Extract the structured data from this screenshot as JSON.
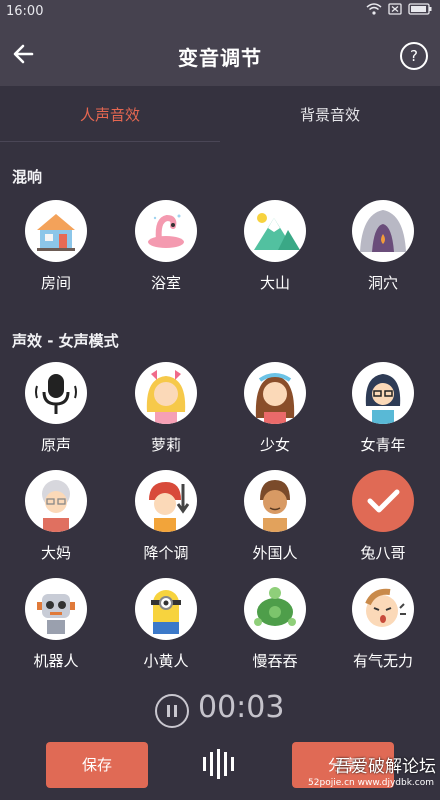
{
  "status": {
    "time": "16:00"
  },
  "header": {
    "title": "变音调节",
    "help": "?"
  },
  "tabs": [
    {
      "label": "人声音效",
      "active": true
    },
    {
      "label": "背景音效",
      "active": false
    }
  ],
  "sections": [
    {
      "title": "混响",
      "items": [
        {
          "label": "房间",
          "icon": "house-icon"
        },
        {
          "label": "浴室",
          "icon": "flamingo-float-icon"
        },
        {
          "label": "大山",
          "icon": "mountain-icon"
        },
        {
          "label": "洞穴",
          "icon": "cave-icon"
        }
      ]
    },
    {
      "title": "声效 - 女声模式",
      "items": [
        {
          "label": "原声",
          "icon": "microphone-icon"
        },
        {
          "label": "萝莉",
          "icon": "loli-girl-icon"
        },
        {
          "label": "少女",
          "icon": "girl-icon"
        },
        {
          "label": "女青年",
          "icon": "young-woman-icon"
        },
        {
          "label": "大妈",
          "icon": "auntie-icon"
        },
        {
          "label": "降个调",
          "icon": "pitch-down-icon"
        },
        {
          "label": "外国人",
          "icon": "foreigner-icon"
        },
        {
          "label": "兔八哥",
          "icon": "selected-check-icon"
        },
        {
          "label": "机器人",
          "icon": "robot-icon"
        },
        {
          "label": "小黄人",
          "icon": "minion-icon"
        },
        {
          "label": "慢吞吞",
          "icon": "turtle-icon"
        },
        {
          "label": "有气无力",
          "icon": "tired-face-icon"
        }
      ]
    }
  ],
  "player": {
    "time": "00:03"
  },
  "buttons": {
    "save": "保存",
    "share": "分享"
  },
  "watermark": {
    "main": "吾爱破解论坛",
    "sub": "52pojie.cn  www.djydbk.com"
  },
  "colors": {
    "accent": "#e56751",
    "background": "#35323f",
    "header": "#46424f"
  }
}
